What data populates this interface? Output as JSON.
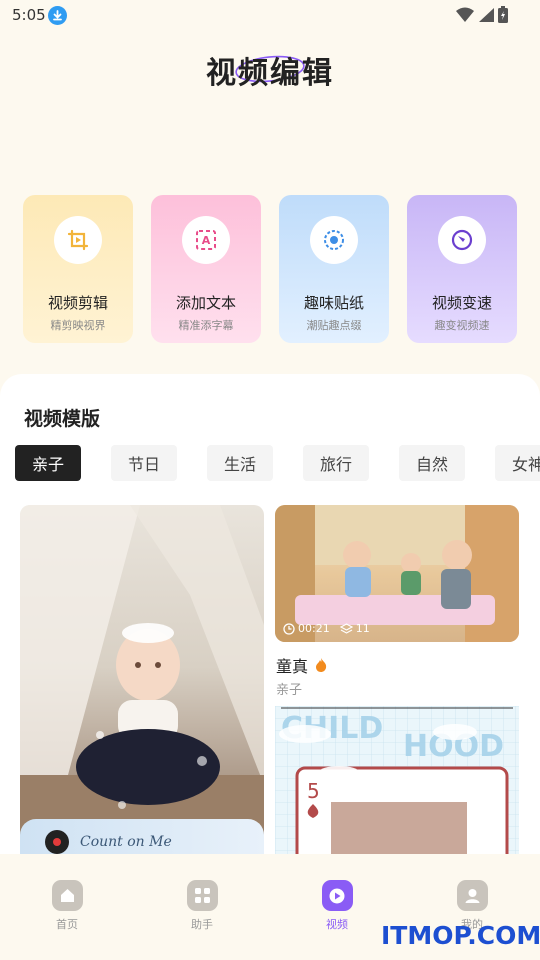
{
  "status": {
    "time": "5:05"
  },
  "header": {
    "title": "视频编辑"
  },
  "tools": [
    {
      "name": "视频剪辑",
      "sub": "精剪映视界",
      "icon": "crop-play-icon",
      "bg": "#fde8b4",
      "accent": "#f2b43a"
    },
    {
      "name": "添加文本",
      "sub": "精准添字幕",
      "icon": "text-frame-icon",
      "bg": "#fdc3dc",
      "accent": "#e84c8a"
    },
    {
      "name": "趣味贴纸",
      "sub": "潮贴趣点缀",
      "icon": "sticker-icon",
      "bg": "#c2e0fb",
      "accent": "#3e8ee6"
    },
    {
      "name": "视频变速",
      "sub": "趣变视频速",
      "icon": "speed-icon",
      "bg": "#cbbaf7",
      "accent": "#6b3fcf"
    }
  ],
  "templates": {
    "section_title": "视频模版",
    "chips": [
      "亲子",
      "节日",
      "生活",
      "旅行",
      "自然",
      "女神"
    ],
    "active_chip": 0,
    "cards": [
      {
        "duration": "00:21",
        "layers": "11",
        "name": "童真",
        "category": "亲子"
      }
    ],
    "music_title": "Count on Me"
  },
  "nav": [
    {
      "label": "首页",
      "icon": "home-icon"
    },
    {
      "label": "助手",
      "icon": "grid-icon"
    },
    {
      "label": "视频",
      "icon": "play-icon"
    },
    {
      "label": "我的",
      "icon": "profile-icon"
    }
  ],
  "active_nav": 2,
  "watermark": "ITMOP.COM"
}
